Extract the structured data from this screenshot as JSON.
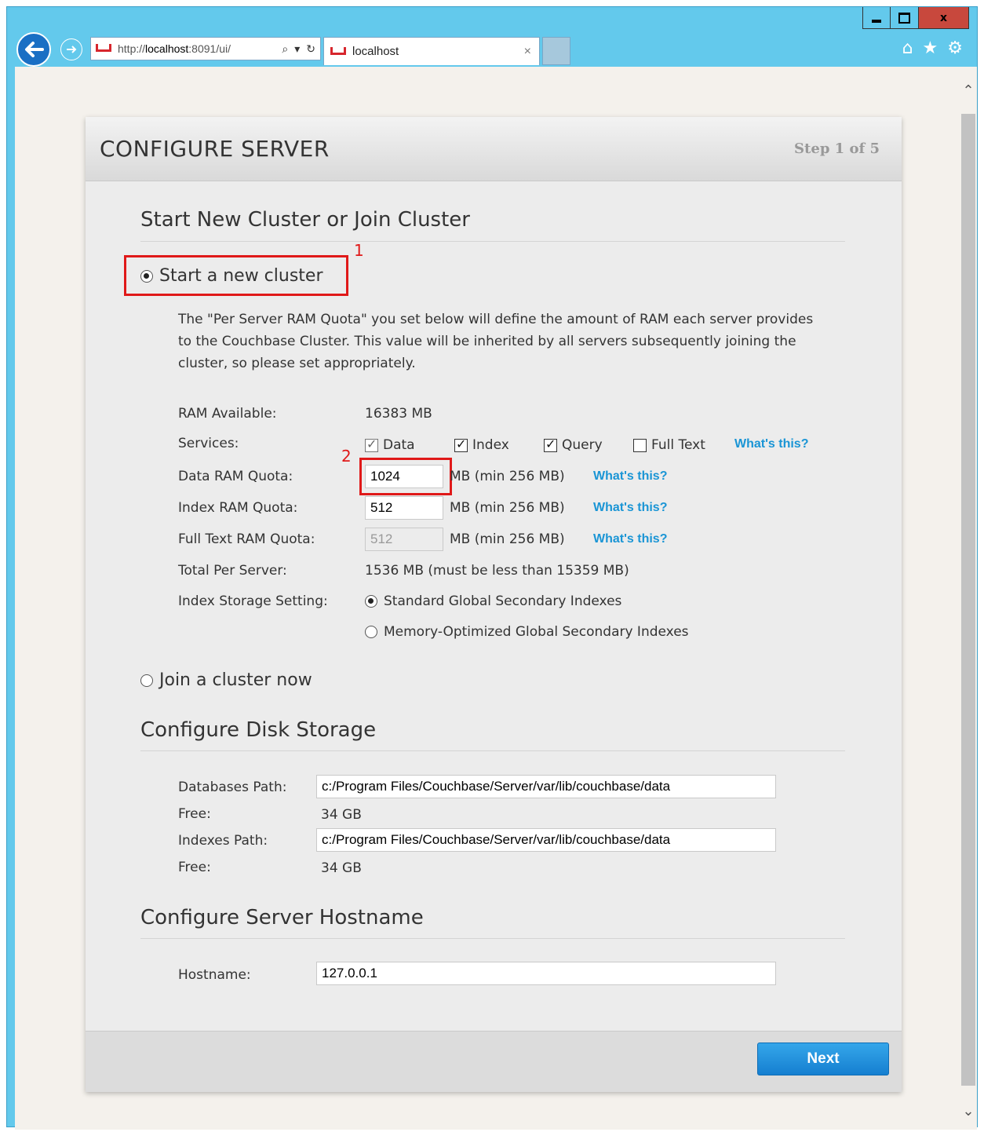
{
  "browser": {
    "address": {
      "prefix": "http://",
      "host": "localhost",
      "rest": ":8091/ui/"
    },
    "tab_title": "localhost",
    "tab_close": "×"
  },
  "panel": {
    "title": "CONFIGURE SERVER",
    "step": "Step 1 of 5"
  },
  "cluster": {
    "section_title": "Start New Cluster or Join Cluster",
    "start_new_label": "Start a new cluster",
    "description": "The \"Per Server RAM Quota\" you set below will define the amount of RAM each server provides to the Couchbase Cluster. This value will be inherited by all servers subsequently joining the cluster, so please set appropriately.",
    "ram_available_label": "RAM Available:",
    "ram_available_value": "16383 MB",
    "services_label": "Services:",
    "services": [
      {
        "label": "Data",
        "checked": true,
        "disabled": true
      },
      {
        "label": "Index",
        "checked": true
      },
      {
        "label": "Query",
        "checked": true
      },
      {
        "label": "Full Text",
        "checked": false
      }
    ],
    "whats_this": "What's this?",
    "data_quota_label": "Data RAM Quota:",
    "data_quota_value": "1024",
    "index_quota_label": "Index RAM Quota:",
    "index_quota_value": "512",
    "fts_quota_label": "Full Text RAM Quota:",
    "fts_quota_value": "512",
    "min_unit": "MB (min 256 MB)",
    "total_label": "Total Per Server:",
    "total_value": "1536 MB (must be less than 15359 MB)",
    "index_storage_label": "Index Storage Setting:",
    "index_storage_options": [
      "Standard Global Secondary Indexes",
      "Memory-Optimized Global Secondary Indexes"
    ],
    "join_label": "Join a cluster now"
  },
  "disk": {
    "section_title": "Configure Disk Storage",
    "db_path_label": "Databases Path:",
    "db_path_value": "c:/Program Files/Couchbase/Server/var/lib/couchbase/data",
    "free_label": "Free:",
    "db_free": "34 GB",
    "idx_path_label": "Indexes Path:",
    "idx_path_value": "c:/Program Files/Couchbase/Server/var/lib/couchbase/data",
    "idx_free": "34 GB"
  },
  "hostname": {
    "section_title": "Configure Server Hostname",
    "label": "Hostname:",
    "value": "127.0.0.1"
  },
  "annotations": {
    "one": "1",
    "two": "2"
  },
  "footer": {
    "next_label": "Next"
  },
  "colors": {
    "accent": "#1a95d5",
    "annotation": "#e01919",
    "chrome": "#63c9ec"
  }
}
